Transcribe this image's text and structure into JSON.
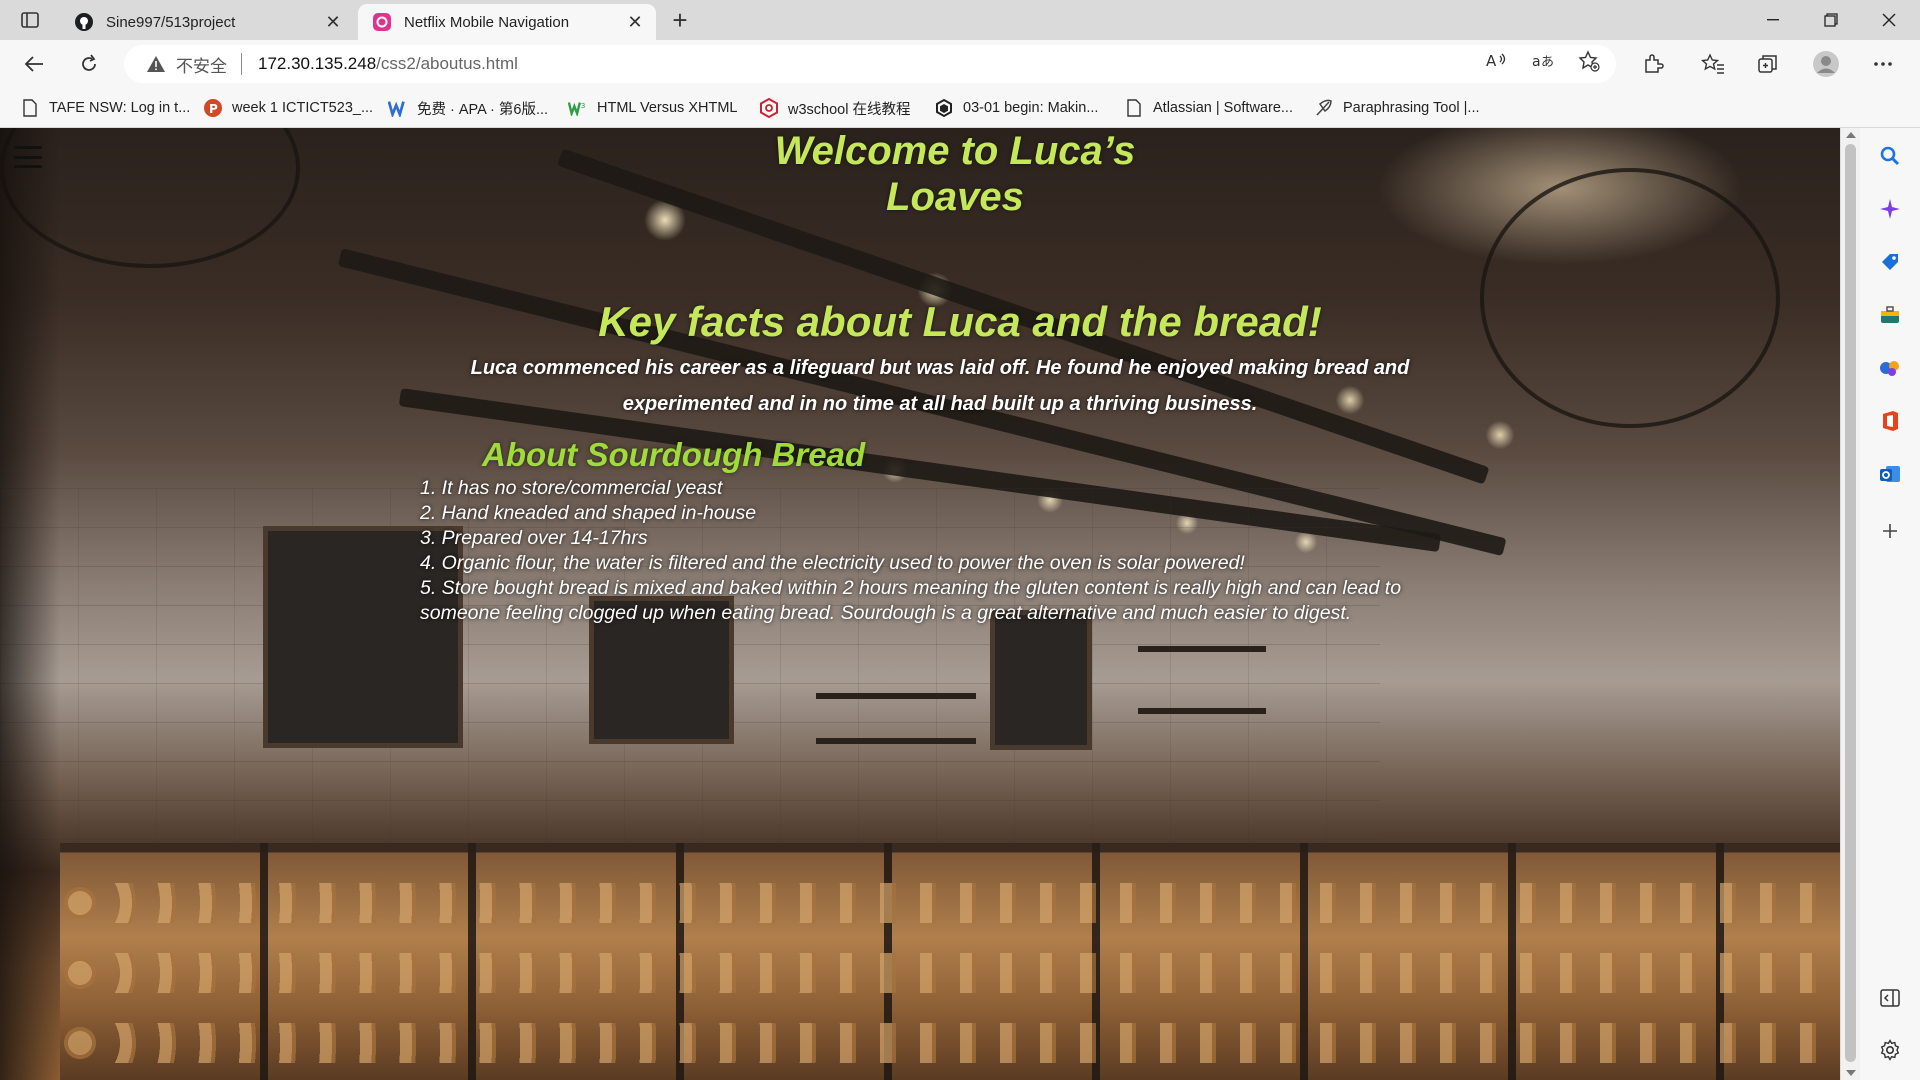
{
  "browser": {
    "tabs": [
      {
        "title": "Sine997/513project",
        "favicon": "github-icon",
        "active": false
      },
      {
        "title": "Netflix Mobile Navigation",
        "favicon": "page-favicon-icon",
        "active": true
      }
    ],
    "address": {
      "security_label": "不安全",
      "host": "172.30.135.248",
      "path": "/css2/aboutus.html"
    },
    "favorites": [
      {
        "label": "TAFE NSW: Log in t...",
        "icon": "document-icon"
      },
      {
        "label": "week 1 ICTICT523_...",
        "icon": "powerpoint-icon"
      },
      {
        "label": "免费 · APA · 第6版...",
        "icon": "cite-icon"
      },
      {
        "label": "HTML Versus XHTML",
        "icon": "w3-icon"
      },
      {
        "label": "w3school 在线教程",
        "icon": "w3school-icon"
      },
      {
        "label": "03-01 begin: Makin...",
        "icon": "openai-icon"
      },
      {
        "label": "Atlassian | Software...",
        "icon": "document-icon"
      },
      {
        "label": "Paraphrasing Tool |...",
        "icon": "feather-icon"
      }
    ]
  },
  "page": {
    "welcome_title": "Welcome to Luca’s Loaves",
    "key_facts_title": "Key facts about Luca and the bread!",
    "intro_line1": "Luca commenced his career as a lifeguard but was laid off. He found he enjoyed making bread and",
    "intro_line2": "experimented and in no time at all had built up a thriving business.",
    "sourdough_title": "About Sourdough Bread",
    "facts": [
      "1. It has no store/commercial yeast",
      "2. Hand kneaded and shaped in-house",
      "3. Prepared over 14-17hrs",
      "4. Organic flour, the water is filtered and the electricity used to power the oven is solar powered!",
      "5. Store bought bread is mixed and baked within 2 hours meaning the gluten content is really high and can lead to someone feeling clogged up when eating bread. Sourdough is a great alternative and much easier to digest."
    ]
  },
  "colors": {
    "heading_green": "#c4e85a",
    "subheading_green": "#9fdc3a",
    "body_text": "#ffffff"
  }
}
